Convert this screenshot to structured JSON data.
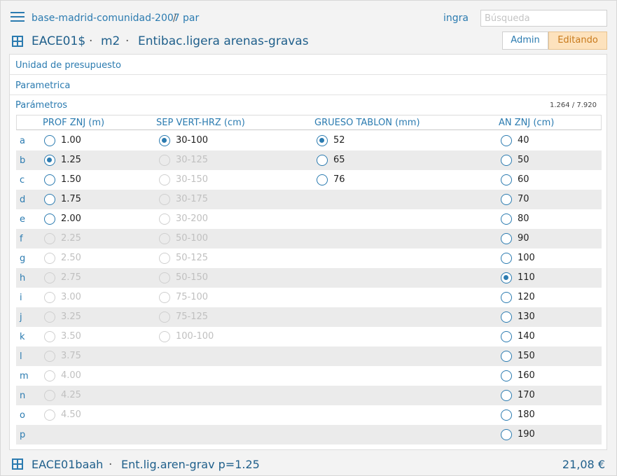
{
  "breadcrumb": {
    "root": "base-madrid-comunidad-2007",
    "separator": "/",
    "current": "par"
  },
  "user": "ingra",
  "search": {
    "placeholder": "Búsqueda",
    "value": ""
  },
  "title": {
    "code": "EACE01$",
    "sep": "·",
    "unit": "m2",
    "description": "Entibac.ligera arenas-gravas"
  },
  "mode_buttons": {
    "admin": "Admin",
    "editing": "Editando"
  },
  "sections": {
    "unit": "Unidad de presupuesto",
    "parametric": "Parametrica",
    "params": "Parámetros"
  },
  "counter": "1.264 / 7.920",
  "columns": [
    "PROF ZNJ (m)",
    "SEP VERT-HRZ (cm)",
    "GRUESO TABLON (mm)",
    "AN ZNJ (cm)"
  ],
  "row_letters": [
    "a",
    "b",
    "c",
    "d",
    "e",
    "f",
    "g",
    "h",
    "i",
    "j",
    "k",
    "l",
    "m",
    "n",
    "o",
    "p"
  ],
  "options": {
    "prof": [
      {
        "label": "1.00",
        "state": "enabled"
      },
      {
        "label": "1.25",
        "state": "checked"
      },
      {
        "label": "1.50",
        "state": "enabled"
      },
      {
        "label": "1.75",
        "state": "enabled"
      },
      {
        "label": "2.00",
        "state": "enabled"
      },
      {
        "label": "2.25",
        "state": "disabled"
      },
      {
        "label": "2.50",
        "state": "disabled"
      },
      {
        "label": "2.75",
        "state": "disabled"
      },
      {
        "label": "3.00",
        "state": "disabled"
      },
      {
        "label": "3.25",
        "state": "disabled"
      },
      {
        "label": "3.50",
        "state": "disabled"
      },
      {
        "label": "3.75",
        "state": "disabled"
      },
      {
        "label": "4.00",
        "state": "disabled"
      },
      {
        "label": "4.25",
        "state": "disabled"
      },
      {
        "label": "4.50",
        "state": "disabled"
      }
    ],
    "sep": [
      {
        "label": "30-100",
        "state": "checked"
      },
      {
        "label": "30-125",
        "state": "disabled"
      },
      {
        "label": "30-150",
        "state": "disabled"
      },
      {
        "label": "30-175",
        "state": "disabled"
      },
      {
        "label": "30-200",
        "state": "disabled"
      },
      {
        "label": "50-100",
        "state": "disabled"
      },
      {
        "label": "50-125",
        "state": "disabled"
      },
      {
        "label": "50-150",
        "state": "disabled"
      },
      {
        "label": "75-100",
        "state": "disabled"
      },
      {
        "label": "75-125",
        "state": "disabled"
      },
      {
        "label": "100-100",
        "state": "disabled"
      }
    ],
    "grueso": [
      {
        "label": "52",
        "state": "checked"
      },
      {
        "label": "65",
        "state": "enabled"
      },
      {
        "label": "76",
        "state": "enabled"
      }
    ],
    "ancho": [
      {
        "label": "40",
        "state": "enabled"
      },
      {
        "label": "50",
        "state": "enabled"
      },
      {
        "label": "60",
        "state": "enabled"
      },
      {
        "label": "70",
        "state": "enabled"
      },
      {
        "label": "80",
        "state": "enabled"
      },
      {
        "label": "90",
        "state": "enabled"
      },
      {
        "label": "100",
        "state": "enabled"
      },
      {
        "label": "110",
        "state": "checked"
      },
      {
        "label": "120",
        "state": "enabled"
      },
      {
        "label": "130",
        "state": "enabled"
      },
      {
        "label": "140",
        "state": "enabled"
      },
      {
        "label": "150",
        "state": "enabled"
      },
      {
        "label": "160",
        "state": "enabled"
      },
      {
        "label": "170",
        "state": "enabled"
      },
      {
        "label": "180",
        "state": "enabled"
      },
      {
        "label": "190",
        "state": "enabled"
      }
    ]
  },
  "footer": {
    "code": "EACE01baah",
    "sep": "·",
    "description": "Ent.lig.aren-grav p=1.25",
    "price": "21,08 €"
  },
  "colors": {
    "accent": "#2b7bb0",
    "editing_bg": "#fde2bd",
    "editing_text": "#c87a1c"
  }
}
